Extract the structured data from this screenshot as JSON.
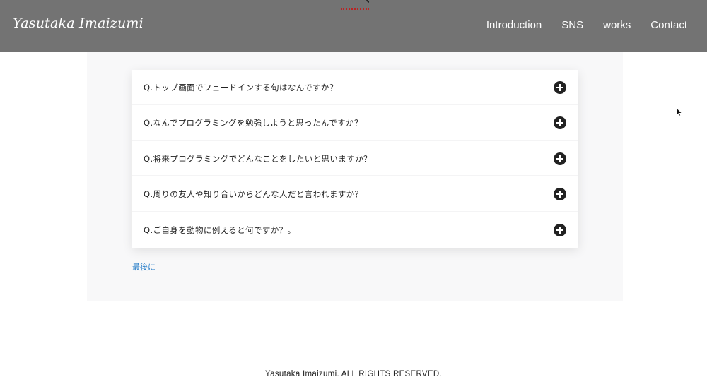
{
  "header": {
    "title": "Yasutaka Imaizumi",
    "nav": [
      "Introduction",
      "SNS",
      "works",
      "Contact"
    ]
  },
  "faq": {
    "items": [
      "Q.トップ画面でフェードインする句はなんですか？",
      "Q.なんでプログラミングを勉強しようと思ったんですか？",
      "Q.将来プログラミングでどんなことをしたいと思いますか？",
      "Q.周りの友人や知り合いからどんな人だと言われますか？",
      "Q.ご自身を動物に例えると何ですか？。"
    ],
    "icon": "plus-circle-icon"
  },
  "links": {
    "last": "最後に"
  },
  "footer": {
    "copyright": "Yasutaka Imaizumi. ALL RIGHTS RESERVED."
  },
  "colors": {
    "header_bg": "#6e6e6e",
    "link": "#2a7fc9",
    "panel_bg": "#f8f8f9",
    "icon": "#222222"
  }
}
